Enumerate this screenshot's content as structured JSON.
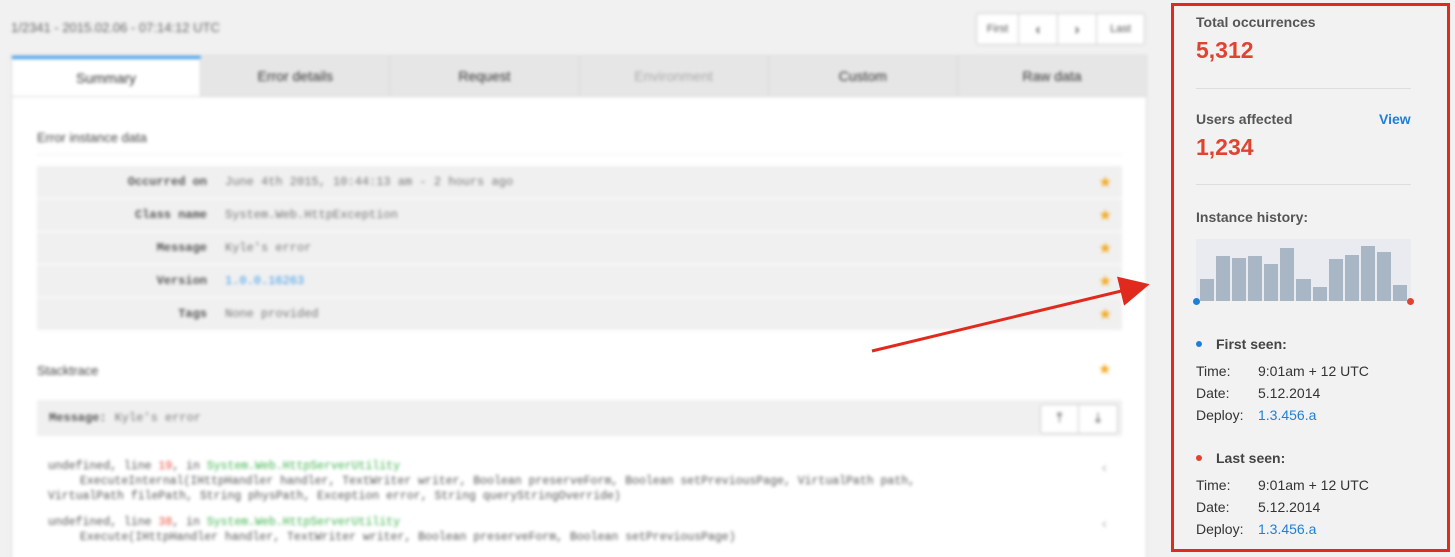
{
  "instance": {
    "header": "1/2341 - 2015.02.06 - 07:14:12 UTC",
    "pager": {
      "first": "First",
      "prev": "‹",
      "next": "›",
      "last": "Last"
    }
  },
  "tabs": [
    {
      "label": "Summary",
      "active": true
    },
    {
      "label": "Error details"
    },
    {
      "label": "Request"
    },
    {
      "label": "Environment",
      "disabled": true
    },
    {
      "label": "Custom"
    },
    {
      "label": "Raw data"
    }
  ],
  "error_instance": {
    "title": "Error instance data",
    "rows": [
      {
        "label": "Occurred on",
        "value": "June 4th 2015, 10:44:13 am - 2 hours ago"
      },
      {
        "label": "Class name",
        "value": "System.Web.HttpException"
      },
      {
        "label": "Message",
        "value": "Kyle's error"
      },
      {
        "label": "Version",
        "value": "1.0.0.16263"
      },
      {
        "label": "Tags",
        "value": "None provided"
      }
    ]
  },
  "stacktrace": {
    "title": "Stacktrace",
    "message_label": "Message:",
    "message_value": "Kyle's error",
    "frames": [
      {
        "prefix": "undefined, line ",
        "line": "19",
        "mid": ", in ",
        "ns": "System.Web.HttpServerUtility",
        "detail1": "ExecuteInternal(IHttpHandler handler, TextWriter writer, Boolean preserveForm, Boolean setPreviousPage, VirtualPath path,",
        "detail2": "VirtualPath filePath, String physPath, Exception error, String queryStringOverride)"
      },
      {
        "prefix": "undefined, line ",
        "line": "38",
        "mid": ", in ",
        "ns": "System.Web.HttpServerUtility",
        "detail1": "Execute(IHttpHandler handler, TextWriter writer, Boolean preserveForm, Boolean setPreviousPage)"
      }
    ]
  },
  "sidebar": {
    "total_label": "Total occurrences",
    "total_value": "5,312",
    "users_label": "Users affected",
    "users_value": "1,234",
    "view_label": "View",
    "history_label": "Instance history:",
    "history": [
      0.38,
      0.77,
      0.74,
      0.77,
      0.64,
      0.92,
      0.38,
      0.25,
      0.72,
      0.79,
      0.95,
      0.84,
      0.27
    ],
    "first_seen": {
      "heading": "First seen:",
      "time_label": "Time:",
      "time": "9:01am + 12 UTC",
      "date_label": "Date:",
      "date": "5.12.2014",
      "deploy_label": "Deploy:",
      "deploy": "1.3.456.a"
    },
    "last_seen": {
      "heading": "Last seen:",
      "time_label": "Time:",
      "time": "9:01am + 12 UTC",
      "date_label": "Date:",
      "date": "5.12.2014",
      "deploy_label": "Deploy:",
      "deploy": "1.3.456.a"
    }
  },
  "colors": {
    "accent": "#3d9be9",
    "stat_red": "#e0432f",
    "highlight_border": "#e02a1e",
    "first_dot": "#1e7fd8",
    "last_dot": "#e0432f"
  }
}
